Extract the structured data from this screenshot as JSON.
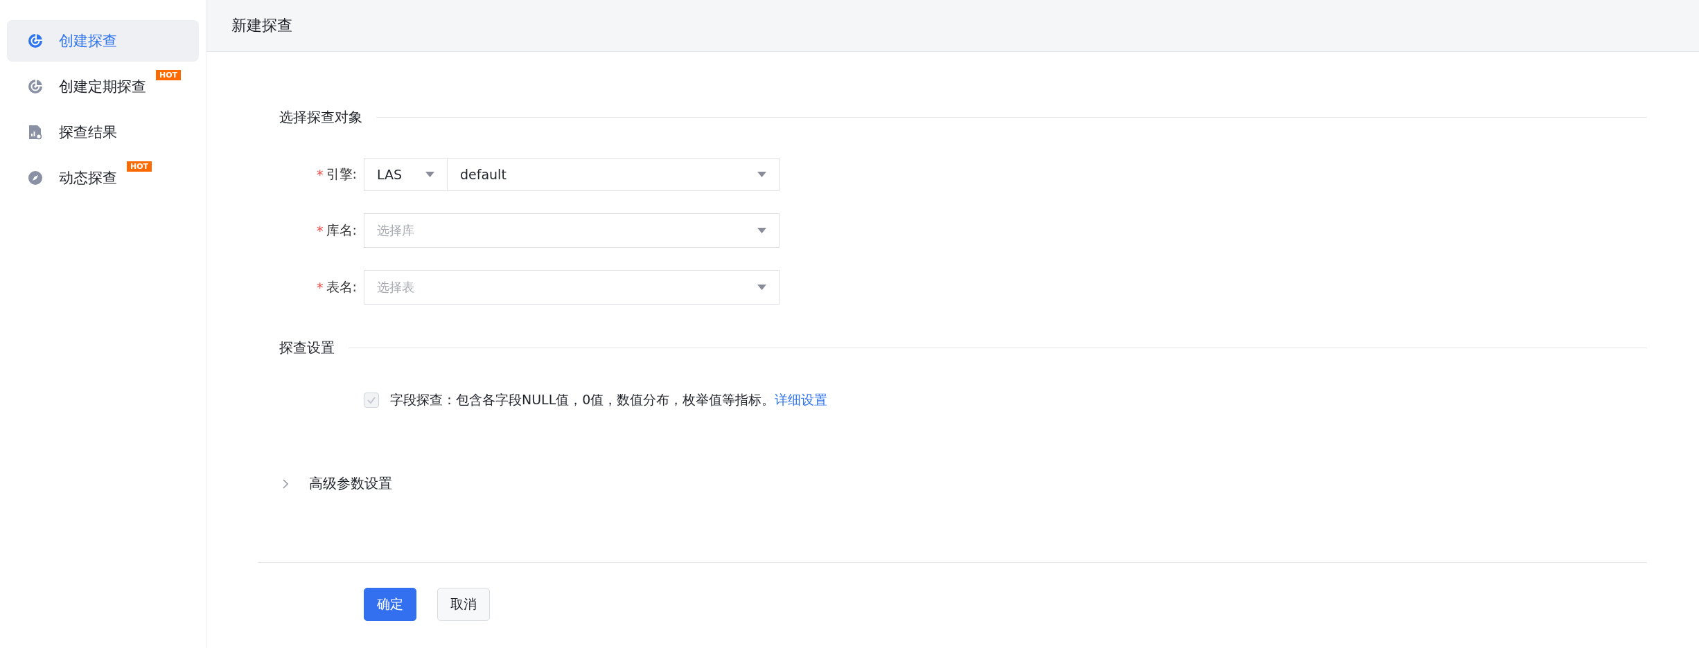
{
  "sidebar": {
    "items": [
      {
        "label": "创建探查",
        "kind": "radar",
        "selected": true
      },
      {
        "label": "创建定期探查",
        "kind": "radar",
        "selected": false,
        "badge": "HOT"
      },
      {
        "label": "探查结果",
        "kind": "report",
        "selected": false
      },
      {
        "label": "动态探查",
        "kind": "compass",
        "selected": false,
        "badge": "HOT"
      }
    ]
  },
  "header": {
    "title": "新建探查"
  },
  "sections": [
    {
      "title": "选择探查对象",
      "fields": [
        {
          "kind": "engine",
          "label": "引擎:",
          "required_mark": "*",
          "engine": "LAS",
          "value": "default"
        },
        {
          "kind": "select",
          "label": "库名:",
          "required_mark": "*",
          "placeholder": "选择库"
        },
        {
          "kind": "select",
          "label": "表名:",
          "required_mark": "*",
          "placeholder": "选择表"
        }
      ]
    },
    {
      "title": "探查设置",
      "checkbox": {
        "checked": true,
        "disabled": true,
        "label": "字段探查：包含各字段NULL值，0值，数值分布，枚举值等指标。",
        "link": "详细设置"
      }
    }
  ],
  "advanced": {
    "label": "高级参数设置",
    "expanded": false
  },
  "buttons": [
    {
      "label": "确定",
      "kind": "primary"
    },
    {
      "label": "取消",
      "kind": "default"
    }
  ]
}
